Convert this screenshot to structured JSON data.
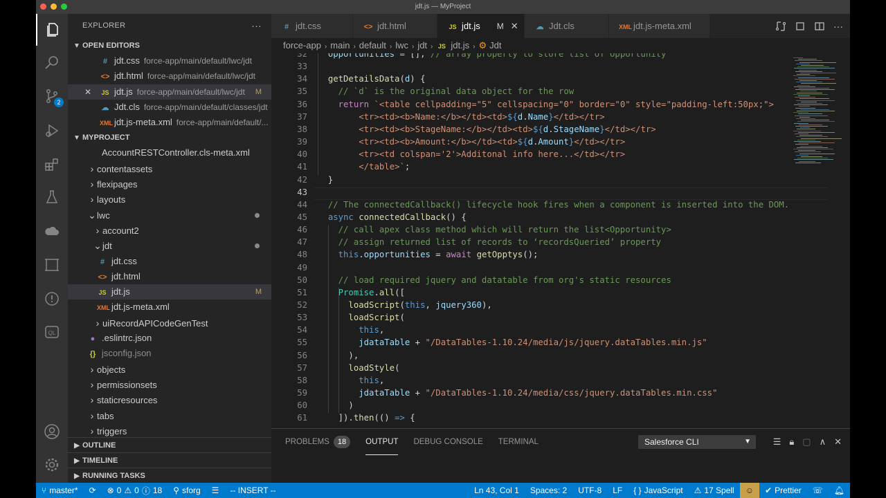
{
  "window": {
    "title": "jdt.js — MyProject"
  },
  "activity_bar": {
    "source_control_badge": "2"
  },
  "sidebar": {
    "title": "EXPLORER",
    "open_editors_title": "OPEN EDITORS",
    "open_editors": [
      {
        "name": "jdt.css",
        "desc": "force-app/main/default/lwc/jdt",
        "type": "css",
        "status": ""
      },
      {
        "name": "jdt.html",
        "desc": "force-app/main/default/lwc/jdt",
        "type": "html",
        "status": ""
      },
      {
        "name": "jdt.js",
        "desc": "force-app/main/default/lwc/jdt",
        "type": "js",
        "status": "M"
      },
      {
        "name": "Jdt.cls",
        "desc": "force-app/main/default/classes/jdt",
        "type": "cls",
        "status": ""
      },
      {
        "name": "jdt.js-meta.xml",
        "desc": "force-app/main/default/...",
        "type": "xml",
        "status": ""
      }
    ],
    "project_title": "MYPROJECT",
    "tree": [
      {
        "label": "AccountRESTController.cls-meta.xml",
        "indent": 1,
        "kind": "xml-file"
      },
      {
        "label": "contentassets",
        "indent": 1,
        "kind": "folder"
      },
      {
        "label": "flexipages",
        "indent": 1,
        "kind": "folder"
      },
      {
        "label": "layouts",
        "indent": 1,
        "kind": "folder"
      },
      {
        "label": "lwc",
        "indent": 1,
        "kind": "open-folder",
        "dot": true
      },
      {
        "label": "account2",
        "indent": 2,
        "kind": "folder"
      },
      {
        "label": "jdt",
        "indent": 2,
        "kind": "open-folder",
        "dot": true
      },
      {
        "label": "jdt.css",
        "indent": 3,
        "kind": "css"
      },
      {
        "label": "jdt.html",
        "indent": 3,
        "kind": "html"
      },
      {
        "label": "jdt.js",
        "indent": 3,
        "kind": "js",
        "status": "M"
      },
      {
        "label": "jdt.js-meta.xml",
        "indent": 3,
        "kind": "xml"
      },
      {
        "label": "uiRecordAPICodeGenTest",
        "indent": 2,
        "kind": "folder"
      },
      {
        "label": ".eslintrc.json",
        "indent": 1,
        "kind": "eslint"
      },
      {
        "label": "jsconfig.json",
        "indent": 1,
        "kind": "json"
      },
      {
        "label": "objects",
        "indent": 1,
        "kind": "folder"
      },
      {
        "label": "permissionsets",
        "indent": 1,
        "kind": "folder"
      },
      {
        "label": "staticresources",
        "indent": 1,
        "kind": "folder"
      },
      {
        "label": "tabs",
        "indent": 1,
        "kind": "folder"
      },
      {
        "label": "triggers",
        "indent": 1,
        "kind": "folder"
      }
    ],
    "outline_title": "OUTLINE",
    "timeline_title": "TIMELINE",
    "running_tasks_title": "RUNNING TASKS"
  },
  "tabs": [
    {
      "label": "jdt.css",
      "type": "css",
      "active": false
    },
    {
      "label": "jdt.html",
      "type": "html",
      "active": false
    },
    {
      "label": "jdt.js",
      "type": "js",
      "active": true,
      "modified": "M"
    },
    {
      "label": "Jdt.cls",
      "type": "cls",
      "active": false
    },
    {
      "label": "jdt.js-meta.xml",
      "type": "xml",
      "active": false
    }
  ],
  "breadcrumb": [
    "force-app",
    "main",
    "default",
    "lwc",
    "jdt",
    "jdt.js",
    "Jdt"
  ],
  "editor": {
    "current_line": 43,
    "lines": [
      {
        "n": 32,
        "html": "  <span class='v'>opportunities</span> = []; <span class='c'>// array property to store list of Opportunity</span>"
      },
      {
        "n": 33,
        "html": ""
      },
      {
        "n": 34,
        "html": "  <span class='f'>getDetailsData</span>(<span class='v'>d</span>) {"
      },
      {
        "n": 35,
        "html": "    <span class='c'>// `d` is the original data object for the row</span>"
      },
      {
        "n": 36,
        "html": "    <span class='kc'>return</span> <span class='s'>`&lt;table cellpadding=\"5\" cellspacing=\"0\" border=\"0\" style=\"padding-left:50px;\"&gt;</span>"
      },
      {
        "n": 37,
        "html": "        <span class='s'>&lt;tr&gt;&lt;td&gt;&lt;b&gt;Name:&lt;/b&gt;&lt;/td&gt;&lt;td&gt;</span><span class='k'>${</span><span class='v'>d</span>.<span class='v'>Name</span><span class='k'>}</span><span class='s'>&lt;/td&gt;&lt;/tr&gt;</span>"
      },
      {
        "n": 38,
        "html": "        <span class='s'>&lt;tr&gt;&lt;td&gt;&lt;b&gt;StageName:&lt;/b&gt;&lt;/td&gt;&lt;td&gt;</span><span class='k'>${</span><span class='v'>d</span>.<span class='v'>StageName</span><span class='k'>}</span><span class='s'>&lt;/td&gt;&lt;/tr&gt;</span>"
      },
      {
        "n": 39,
        "html": "        <span class='s'>&lt;tr&gt;&lt;td&gt;&lt;b&gt;Amount:&lt;/b&gt;&lt;/td&gt;&lt;td&gt;</span><span class='k'>${</span><span class='v'>d</span>.<span class='v'>Amount</span><span class='k'>}</span><span class='s'>&lt;/td&gt;&lt;/tr&gt;</span>"
      },
      {
        "n": 40,
        "html": "        <span class='s'>&lt;tr&gt;&lt;td colspan='2'&gt;Additonal info here...&lt;/td&gt;&lt;/tr&gt;</span>"
      },
      {
        "n": 41,
        "html": "        <span class='s'>&lt;/table&gt;`</span>;"
      },
      {
        "n": 42,
        "html": "  }"
      },
      {
        "n": 43,
        "html": ""
      },
      {
        "n": 44,
        "html": "  <span class='c'>// The connectedCallback() lifecycle hook fires when a component is inserted into the DOM.</span>"
      },
      {
        "n": 45,
        "html": "  <span class='k'>async</span> <span class='f'>connectedCallback</span>() {"
      },
      {
        "n": 46,
        "html": "    <span class='c'>// call apex class method which will return the list&lt;Opportunity&gt;</span>"
      },
      {
        "n": 47,
        "html": "    <span class='c'>// assign returned list of records to ‘recordsQueried’ property</span>"
      },
      {
        "n": 48,
        "html": "    <span class='k'>this</span>.<span class='v'>opportunities</span> = <span class='kc'>await</span> <span class='f'>getOpptys</span>();"
      },
      {
        "n": 49,
        "html": ""
      },
      {
        "n": 50,
        "html": "    <span class='c'>// load required jquery and datatable from org's static resources</span>"
      },
      {
        "n": 51,
        "html": "    <span class='t'>Promise</span>.<span class='f'>all</span>(["
      },
      {
        "n": 52,
        "html": "      <span class='f'>loadScript</span>(<span class='k'>this</span>, <span class='v'>jquery360</span>),"
      },
      {
        "n": 53,
        "html": "      <span class='f'>loadScript</span>("
      },
      {
        "n": 54,
        "html": "        <span class='k'>this</span>,"
      },
      {
        "n": 55,
        "html": "        <span class='v'>jdataTable</span> + <span class='s'>\"/DataTables-1.10.24/media/js/jquery.dataTables.min.js\"</span>"
      },
      {
        "n": 56,
        "html": "      ),"
      },
      {
        "n": 57,
        "html": "      <span class='f'>loadStyle</span>("
      },
      {
        "n": 58,
        "html": "        <span class='k'>this</span>,"
      },
      {
        "n": 59,
        "html": "        <span class='v'>jdataTable</span> + <span class='s'>\"/DataTables-1.10.24/media/css/jquery.dataTables.min.css\"</span>"
      },
      {
        "n": 60,
        "html": "      )"
      },
      {
        "n": 61,
        "html": "    ]).<span class='f'>then</span>(() <span class='k'>=&gt;</span> {"
      }
    ]
  },
  "panel": {
    "tabs": [
      {
        "label": "PROBLEMS",
        "badge": "18",
        "active": false
      },
      {
        "label": "OUTPUT",
        "active": true
      },
      {
        "label": "DEBUG CONSOLE",
        "active": false
      },
      {
        "label": "TERMINAL",
        "active": false
      }
    ],
    "output_channel": "Salesforce CLI"
  },
  "statusbar": {
    "branch": "master*",
    "errors": "0",
    "warnings": "0",
    "info": "18",
    "org": "sforg",
    "mode": "-- INSERT --",
    "position": "Ln 43, Col 1",
    "spaces": "Spaces: 2",
    "encoding": "UTF-8",
    "eol": "LF",
    "language": "JavaScript",
    "spell": "17 Spell",
    "prettier": "Prettier"
  },
  "colors": {
    "accent": "#007acc",
    "activity_bg": "#333333",
    "sidebar_bg": "#252526",
    "editor_bg": "#1e1e1e"
  }
}
